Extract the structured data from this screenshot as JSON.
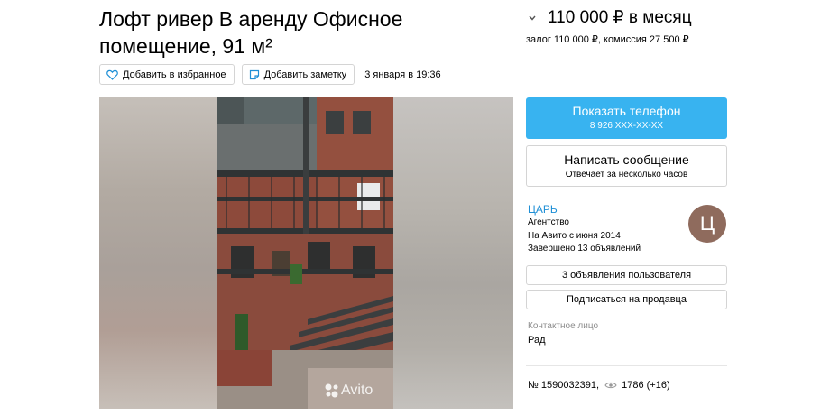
{
  "listing": {
    "title": "Лофт ривер В аренду Офисное помещение, 91 м²",
    "price": "110 000 ₽ в месяц",
    "deposit_line": "залог 110 000 ₽, комиссия 27 500 ₽",
    "date": "3 января в 19:36",
    "number": "№ 1590032391,",
    "views": "1786 (+16)"
  },
  "actions": {
    "favorite_label": "Добавить в избранное",
    "note_label": "Добавить заметку"
  },
  "gallery": {
    "watermark": "Avito"
  },
  "contact_buttons": {
    "phone_label": "Показать телефон",
    "phone_number": "8 926 XXX-XX-XX",
    "message_label": "Написать сообщение",
    "message_sub": "Отвечает за несколько часов"
  },
  "seller": {
    "name": "ЦАРЬ",
    "type": "Агентство",
    "since": "На Авито с июня 2014",
    "completed": "Завершено 13 объявлений",
    "avatar_letter": "Ц",
    "listings_button": "3 объявления пользователя",
    "subscribe_button": "Подписаться на продавца",
    "contact_label": "Контактное лицо",
    "contact_name": "Рад"
  },
  "colors": {
    "accent_blue": "#38b3f0",
    "link_blue": "#1e8fd6",
    "avatar_bg": "#8f6b5d"
  }
}
